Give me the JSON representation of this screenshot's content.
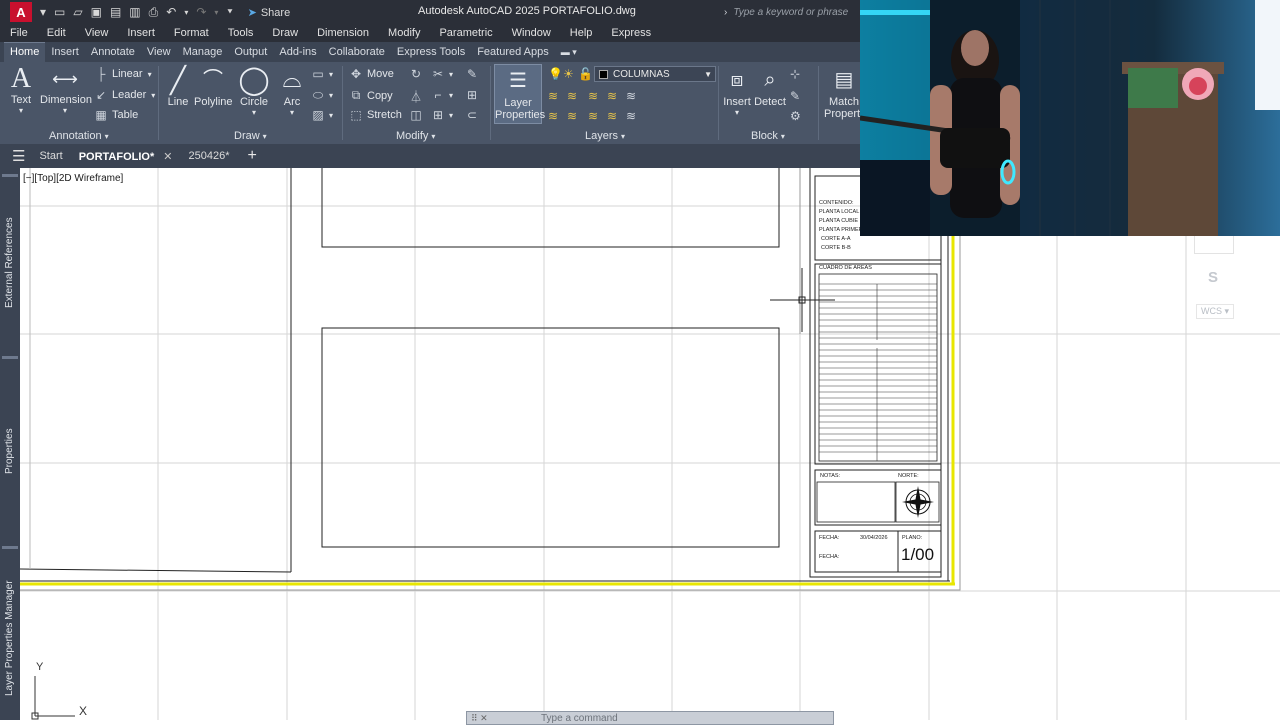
{
  "window": {
    "app_logo": "A",
    "title": "Autodesk AutoCAD 2025   PORTAFOLIO.dwg",
    "share_label": "Share",
    "search_placeholder": "Type a keyword or phrase"
  },
  "menu": [
    "File",
    "Edit",
    "View",
    "Insert",
    "Format",
    "Tools",
    "Draw",
    "Dimension",
    "Modify",
    "Parametric",
    "Window",
    "Help",
    "Express"
  ],
  "ribbon_tabs": [
    "Home",
    "Insert",
    "Annotate",
    "View",
    "Manage",
    "Output",
    "Add-ins",
    "Collaborate",
    "Express Tools",
    "Featured Apps"
  ],
  "ribbon": {
    "annotation": {
      "label": "Annotation",
      "text": "Text",
      "dimension": "Dimension",
      "linear": "Linear",
      "leader": "Leader",
      "table": "Table"
    },
    "draw": {
      "label": "Draw",
      "line": "Line",
      "polyline": "Polyline",
      "circle": "Circle",
      "arc": "Arc"
    },
    "modify": {
      "label": "Modify",
      "move": "Move",
      "copy": "Copy",
      "stretch": "Stretch"
    },
    "layers": {
      "label": "Layers",
      "layer_properties_1": "Layer",
      "layer_properties_2": "Properties",
      "current_layer": "COLUMNAS"
    },
    "block": {
      "label": "Block",
      "insert": "Insert",
      "detect": "Detect"
    },
    "match": {
      "line1": "Match",
      "line2": "Propertie"
    }
  },
  "file_tabs": [
    {
      "label": "Start",
      "active": false,
      "closable": false
    },
    {
      "label": "PORTAFOLIO*",
      "active": true,
      "closable": true
    },
    {
      "label": "250426*",
      "active": false,
      "closable": false
    }
  ],
  "palettes": [
    "External References",
    "Properties",
    "Layer Properties Manager"
  ],
  "viewport_label": "[−][Top][2D Wireframe]",
  "titleblock": {
    "contenido_title": "CONTENIDO:",
    "contenido_items": [
      "PLANTA LOCAL",
      "PLANTA CUBIE",
      "PLANTA PRIMER",
      "CORTE A-A",
      "CORTE B-B"
    ],
    "areas_title": "CUADRO DE AREAS",
    "notas": "NOTAS:",
    "norte": "NORTE:",
    "fecha1_label": "FECHA:",
    "fecha1_value": "30/04/2026",
    "fecha2_label": "FECHA:",
    "plano_label": "PLANO:",
    "plano_value": "1/00"
  },
  "viewcube": {
    "south": "S",
    "wcs": "WCS"
  },
  "ucs": {
    "x": "X",
    "y": "Y"
  },
  "command_line": {
    "placeholder": "Type a command"
  },
  "colors": {
    "titlebar": "#2b2f38",
    "ribbon": "#4a5567",
    "accent_logo": "#c8102e",
    "sheet_border": "#e8e600"
  }
}
